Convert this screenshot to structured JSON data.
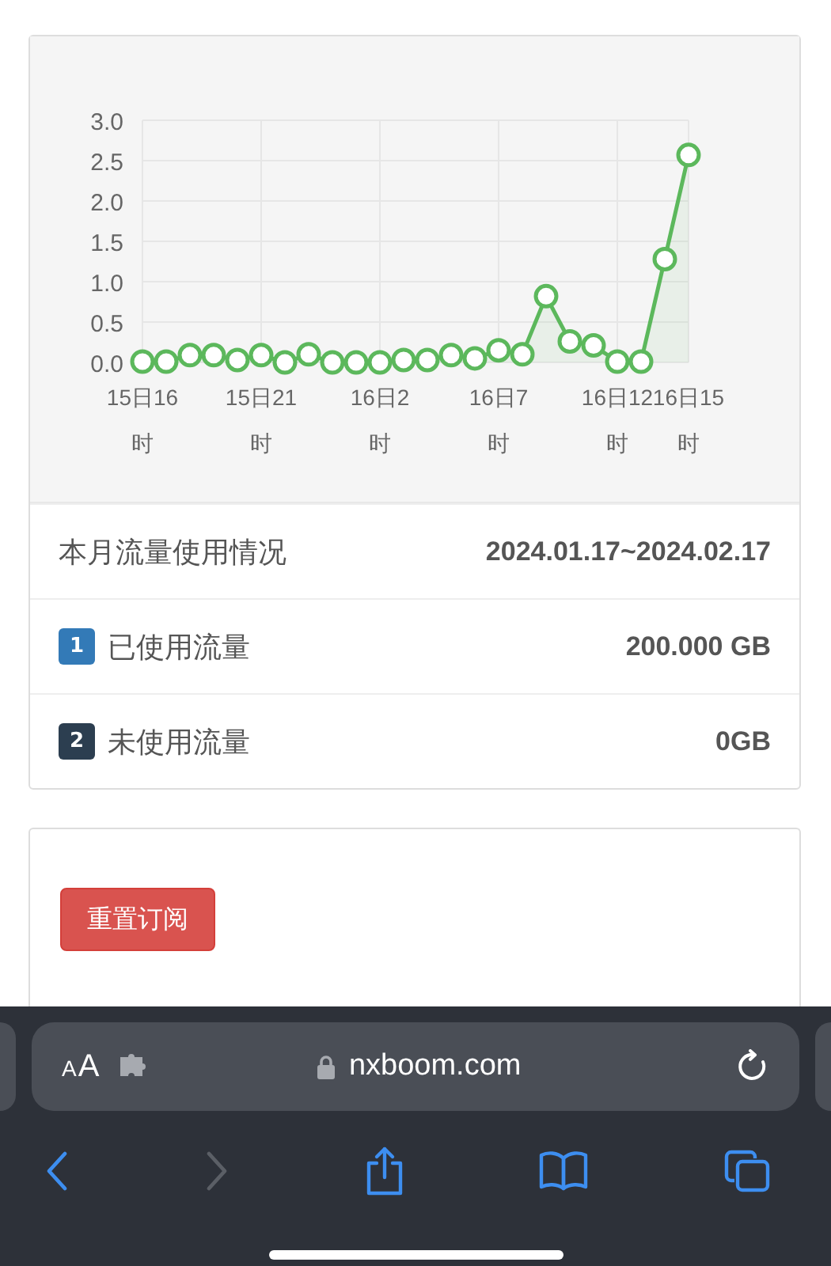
{
  "chart": {
    "chart_data": {
      "type": "line",
      "categories": [
        "15日16时",
        null,
        null,
        null,
        null,
        "15日21时",
        null,
        null,
        null,
        null,
        "16日2时",
        null,
        null,
        null,
        null,
        "16日7时",
        null,
        null,
        null,
        null,
        "16日12时",
        null,
        null,
        "16日15时"
      ],
      "grid": true,
      "series": [
        {
          "color": "#5cb85c",
          "marker": true,
          "values": [
            0.01,
            0.01,
            0.09,
            0.09,
            0.03,
            0.09,
            0,
            0.1,
            0,
            0,
            0,
            0.03,
            0.03,
            0.09,
            0.05,
            0.15,
            0.1,
            0.82,
            0.26,
            0.21,
            0.01,
            0.01,
            1.28,
            2.57
          ]
        }
      ],
      "ylim": [
        0,
        3
      ],
      "yticks": [
        {
          "value": 0,
          "label": "0.0"
        },
        {
          "value": 0.5,
          "label": "0.5"
        },
        {
          "value": 1,
          "label": "1.0"
        },
        {
          "value": 1.5,
          "label": "1.5"
        },
        {
          "value": 2,
          "label": "2.0"
        },
        {
          "value": 2.5,
          "label": "2.5"
        },
        {
          "value": 3,
          "label": "3.0"
        }
      ]
    }
  },
  "usage": {
    "rows": [
      {
        "label": "本月流量使用情况",
        "value": "2024.01.17~2024.02.17"
      },
      {
        "badge": "1",
        "color": "#337ab7",
        "label": "已使用流量",
        "value": "200.000 GB"
      },
      {
        "badge": "2",
        "color": "#2c3e50",
        "label": "未使用流量",
        "value": "0GB"
      }
    ]
  },
  "actions": {
    "buttons": [
      "重置订阅"
    ]
  },
  "browser": {
    "text_size": "AA",
    "url": "nxboom.com",
    "back_enabled": true,
    "forward_enabled": false
  }
}
